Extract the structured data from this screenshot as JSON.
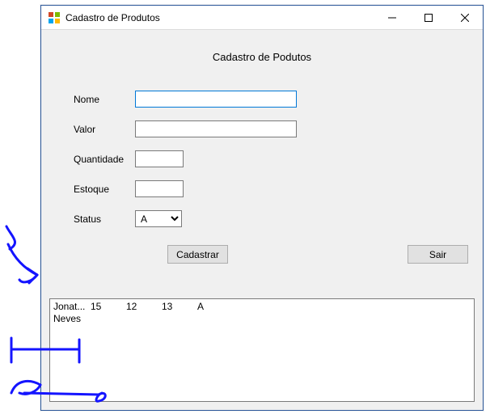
{
  "window": {
    "title": "Cadastro de Produtos"
  },
  "heading": "Cadastro de Podutos",
  "labels": {
    "nome": "Nome",
    "valor": "Valor",
    "quantidade": "Quantidade",
    "estoque": "Estoque",
    "status": "Status"
  },
  "fields": {
    "nome": {
      "value": "",
      "placeholder": ""
    },
    "valor": {
      "value": "",
      "placeholder": ""
    },
    "quantidade": {
      "value": "",
      "placeholder": ""
    },
    "estoque": {
      "value": "",
      "placeholder": ""
    },
    "status": {
      "value": "A"
    }
  },
  "buttons": {
    "cadastrar": "Cadastrar",
    "sair": "Sair"
  },
  "list": {
    "rows": [
      {
        "c0a": "Jonat...",
        "c0b": "Neves",
        "c1": "15",
        "c2": "12",
        "c3": "13",
        "c4": "A"
      }
    ]
  }
}
